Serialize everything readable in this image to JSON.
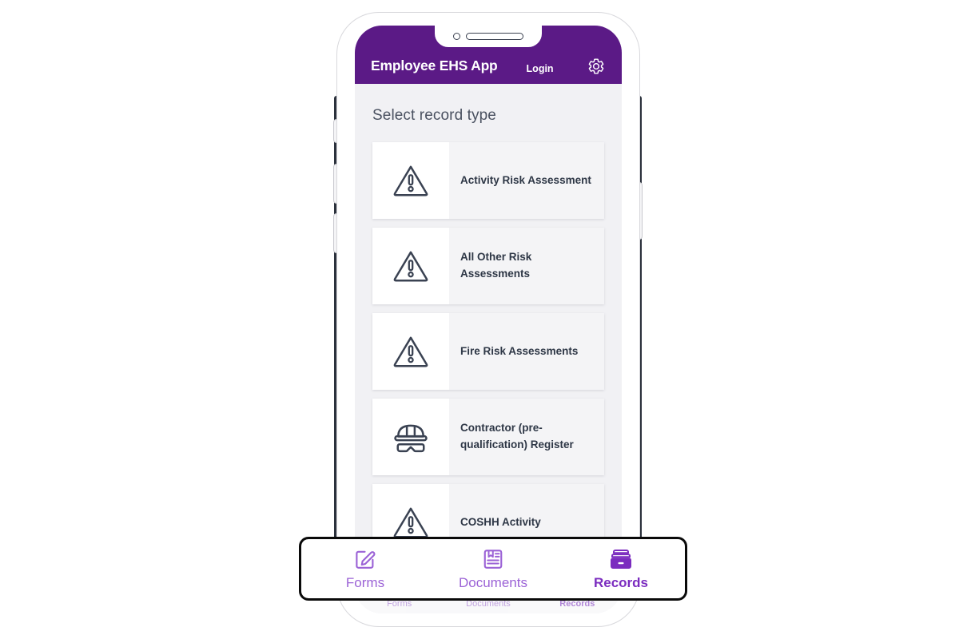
{
  "device": {
    "frame_name": "smartphone-mockup",
    "notch": {
      "camera": "camera-dot",
      "speaker": "speaker-slot"
    }
  },
  "app_bar": {
    "title": "Employee EHS App",
    "login_label": "Login",
    "settings_icon": "gear-icon",
    "background_color": "#5b1a86",
    "text_color": "#ffffff"
  },
  "screen": {
    "title": "Select record type",
    "background_color": "#f1f1f4"
  },
  "record_types": [
    {
      "label": "Activity Risk Assessment",
      "icon": "warning-triangle-icon"
    },
    {
      "label": "All Other Risk Assessments",
      "icon": "warning-triangle-icon"
    },
    {
      "label": "Fire Risk Assessments",
      "icon": "warning-triangle-icon"
    },
    {
      "label": "Contractor (pre-qualification) Register",
      "icon": "hard-hat-goggles-icon"
    },
    {
      "label": "COSHH Activity",
      "icon": "warning-triangle-icon"
    }
  ],
  "bottom_nav": {
    "accent_color": "#7b2cbf",
    "inactive_color": "#9b62d6",
    "items": [
      {
        "label": "Forms",
        "icon": "edit-square-pencil-icon",
        "active": false
      },
      {
        "label": "Documents",
        "icon": "document-lines-icon",
        "active": false
      },
      {
        "label": "Records",
        "icon": "file-box-icon",
        "active": true
      }
    ]
  }
}
